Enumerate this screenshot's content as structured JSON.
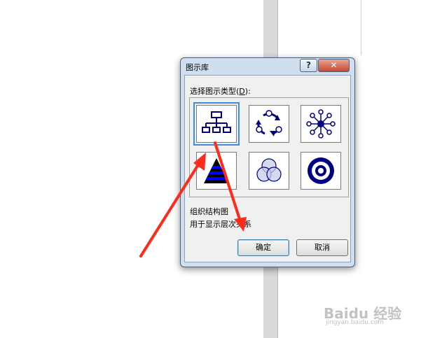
{
  "dialog": {
    "title": "图示库",
    "help_symbol": "?",
    "close_symbol": "✕",
    "prompt_prefix": "选择图示类型(",
    "prompt_mnemonic": "D",
    "prompt_suffix": "):",
    "diagram_types": [
      {
        "icon": "organization-chart-icon",
        "selected": true
      },
      {
        "icon": "cycle-diagram-icon",
        "selected": false
      },
      {
        "icon": "radial-diagram-icon",
        "selected": false
      },
      {
        "icon": "pyramid-diagram-icon",
        "selected": false
      },
      {
        "icon": "venn-diagram-icon",
        "selected": false
      },
      {
        "icon": "target-diagram-icon",
        "selected": false
      }
    ],
    "description_title": "组织结构图",
    "description_text": "用于显示层次关系",
    "ok_label": "确定",
    "cancel_label": "取消"
  },
  "watermark": {
    "text": "Baidu 经验",
    "url": "jingyan.baidu.com"
  },
  "colors": {
    "diagram_blue": "#000080",
    "annotation_arrow": "#ff2a1a",
    "selection_border": "#3d8ee0"
  }
}
